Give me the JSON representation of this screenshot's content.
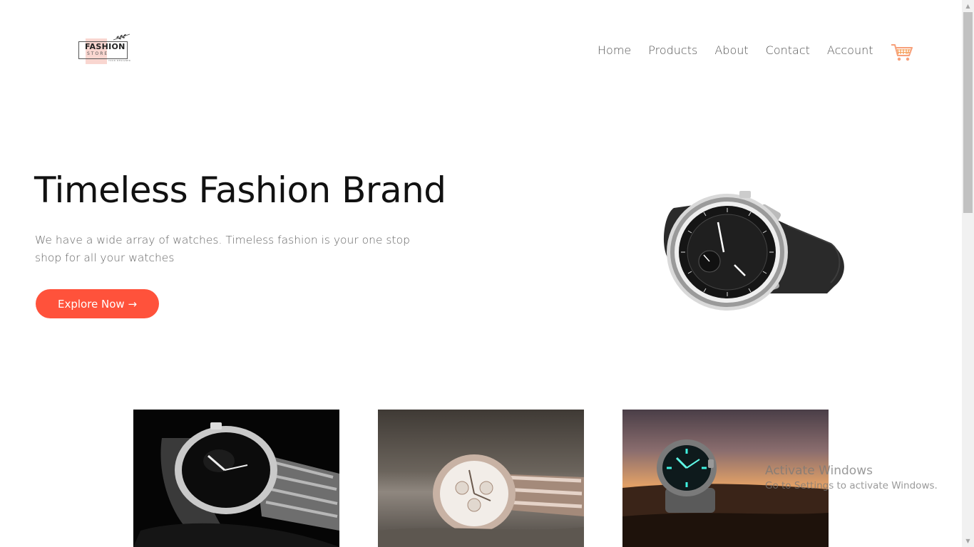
{
  "header": {
    "logo": {
      "word": "FASHION",
      "sub": "STORE",
      "tag": "YOUR DESIGNER"
    },
    "nav": [
      {
        "label": "Home"
      },
      {
        "label": "Products"
      },
      {
        "label": "About"
      },
      {
        "label": "Contact"
      },
      {
        "label": "Account"
      }
    ],
    "cart_icon": "shopping-cart-icon"
  },
  "hero": {
    "title": "Timeless Fashion Brand",
    "text": "We have a wide array of watches. Timeless fashion is your one stop shop for all your watches",
    "cta_label": "Explore Now →",
    "image_icon": "wristwatch-image"
  },
  "featured": [
    {
      "image": "steel-watch-dark-image"
    },
    {
      "image": "rose-gold-watch-image"
    },
    {
      "image": "glowing-dive-watch-sunset-image"
    }
  ],
  "watermark": {
    "title": "Activate Windows",
    "subtitle": "Go to Settings to activate Windows."
  },
  "colors": {
    "accent": "#ff523b",
    "text_dark": "#111111",
    "text_muted": "#666666"
  }
}
